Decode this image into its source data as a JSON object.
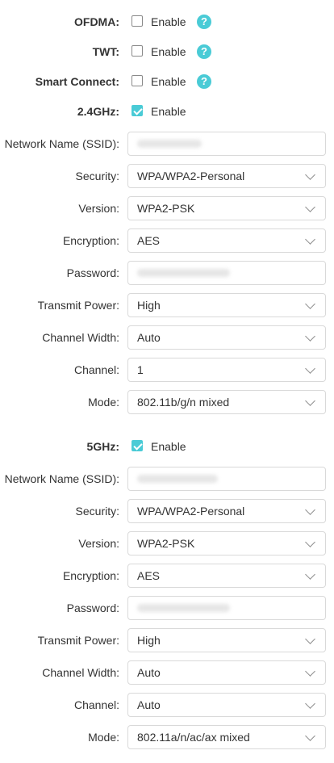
{
  "general": {
    "ofdma_label": "OFDMA:",
    "twt_label": "TWT:",
    "smart_connect_label": "Smart Connect:",
    "enable_text": "Enable",
    "help_glyph": "?"
  },
  "band24": {
    "band_label": "2.4GHz:",
    "enabled": true,
    "ssid_label": "Network Name (SSID):",
    "ssid_value": "",
    "security_label": "Security:",
    "security_value": "WPA/WPA2-Personal",
    "version_label": "Version:",
    "version_value": "WPA2-PSK",
    "encryption_label": "Encryption:",
    "encryption_value": "AES",
    "password_label": "Password:",
    "password_value": "",
    "power_label": "Transmit Power:",
    "power_value": "High",
    "width_label": "Channel Width:",
    "width_value": "Auto",
    "channel_label": "Channel:",
    "channel_value": "1",
    "mode_label": "Mode:",
    "mode_value": "802.11b/g/n mixed"
  },
  "band5": {
    "band_label": "5GHz:",
    "enabled": true,
    "ssid_label": "Network Name (SSID):",
    "ssid_value": "",
    "security_label": "Security:",
    "security_value": "WPA/WPA2-Personal",
    "version_label": "Version:",
    "version_value": "WPA2-PSK",
    "encryption_label": "Encryption:",
    "encryption_value": "AES",
    "password_label": "Password:",
    "password_value": "",
    "power_label": "Transmit Power:",
    "power_value": "High",
    "width_label": "Channel Width:",
    "width_value": "Auto",
    "channel_label": "Channel:",
    "channel_value": "Auto",
    "mode_label": "Mode:",
    "mode_value": "802.11a/n/ac/ax mixed"
  }
}
